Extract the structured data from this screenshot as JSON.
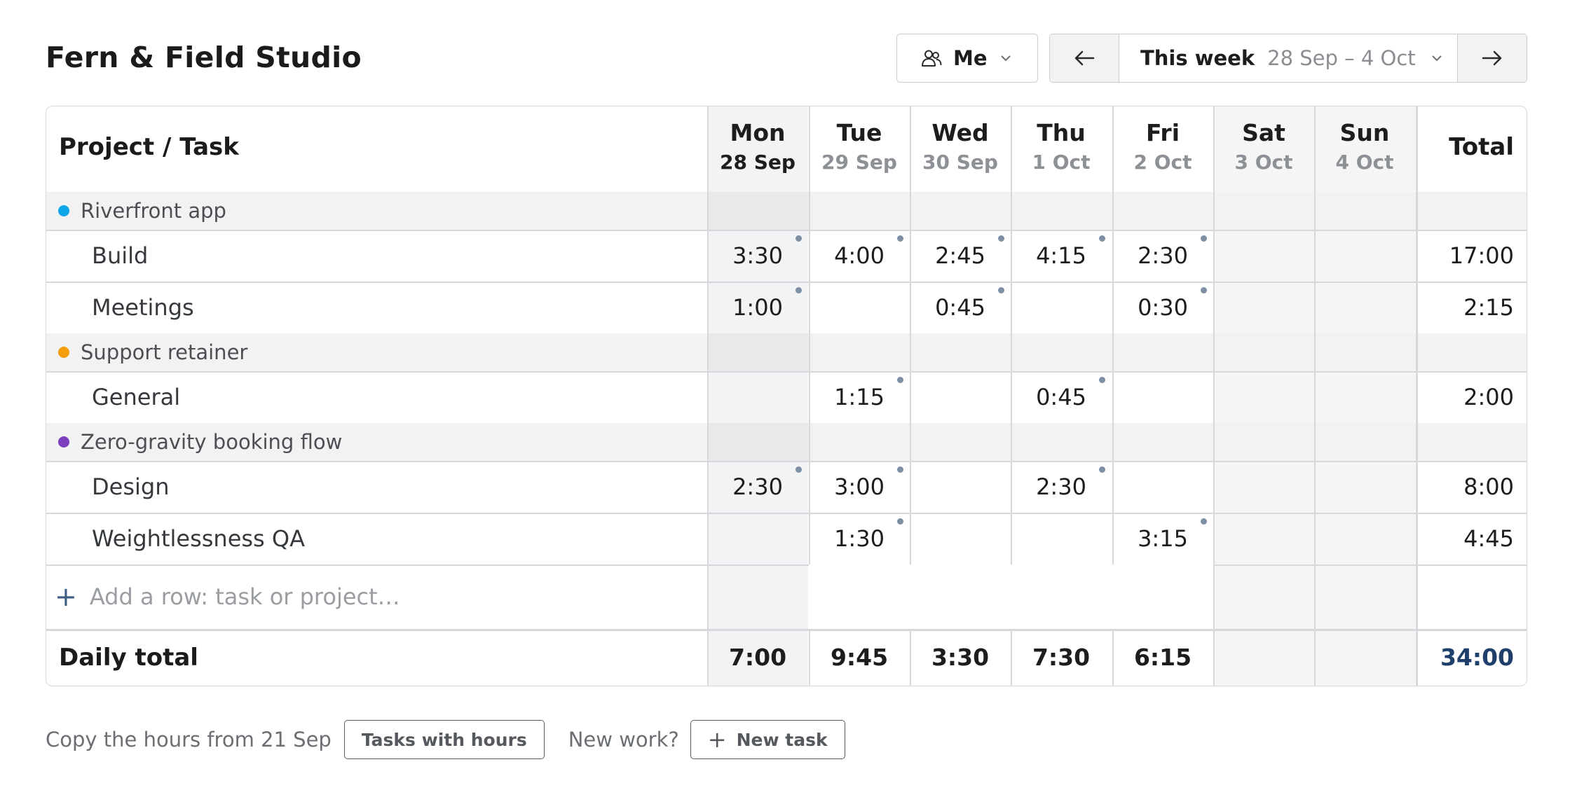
{
  "app": {
    "title": "Fern & Field Studio"
  },
  "toolbar": {
    "person_label": "Me",
    "week_label": "This week",
    "week_range": "28 Sep – 4 Oct"
  },
  "grid": {
    "header_label": "Project / Task",
    "total_label": "Total",
    "days": [
      {
        "name": "Mon",
        "date": "28 Sep",
        "today": true
      },
      {
        "name": "Tue",
        "date": "29 Sep"
      },
      {
        "name": "Wed",
        "date": "30 Sep"
      },
      {
        "name": "Thu",
        "date": "1 Oct"
      },
      {
        "name": "Fri",
        "date": "2 Oct"
      },
      {
        "name": "Sat",
        "date": "3 Oct"
      },
      {
        "name": "Sun",
        "date": "4 Oct"
      }
    ],
    "projects": [
      {
        "name": "Riverfront app",
        "color": "#0ea5e9",
        "tasks": [
          {
            "name": "Build",
            "hours": [
              "3:30",
              "4:00",
              "2:45",
              "4:15",
              "2:30",
              "",
              ""
            ],
            "total": "17:00"
          },
          {
            "name": "Meetings",
            "hours": [
              "1:00",
              "",
              "0:45",
              "",
              "0:30",
              "",
              ""
            ],
            "total": "2:15"
          }
        ]
      },
      {
        "name": "Support retainer",
        "color": "#f59e0b",
        "tasks": [
          {
            "name": "General",
            "hours": [
              "",
              "1:15",
              "",
              "0:45",
              "",
              "",
              ""
            ],
            "total": "2:00"
          }
        ]
      },
      {
        "name": "Zero-gravity booking flow",
        "color": "#7e3fbf",
        "tasks": [
          {
            "name": "Design",
            "hours": [
              "2:30",
              "3:00",
              "",
              "2:30",
              "",
              "",
              ""
            ],
            "total": "8:00"
          },
          {
            "name": "Weightlessness QA",
            "hours": [
              "",
              "1:30",
              "",
              "",
              "3:15",
              "",
              ""
            ],
            "total": "4:45"
          }
        ]
      }
    ],
    "add_row_placeholder": "Add a row: task or project…",
    "daily_total_label": "Daily total",
    "daily_totals": [
      "7:00",
      "9:45",
      "3:30",
      "7:30",
      "6:15",
      "",
      ""
    ],
    "grand_total": "34:00"
  },
  "footer": {
    "copy_text": "Copy the hours from 21 Sep",
    "copy_button": "Tasks with hours",
    "new_work_text": "New work?",
    "new_task_button": "New task"
  }
}
